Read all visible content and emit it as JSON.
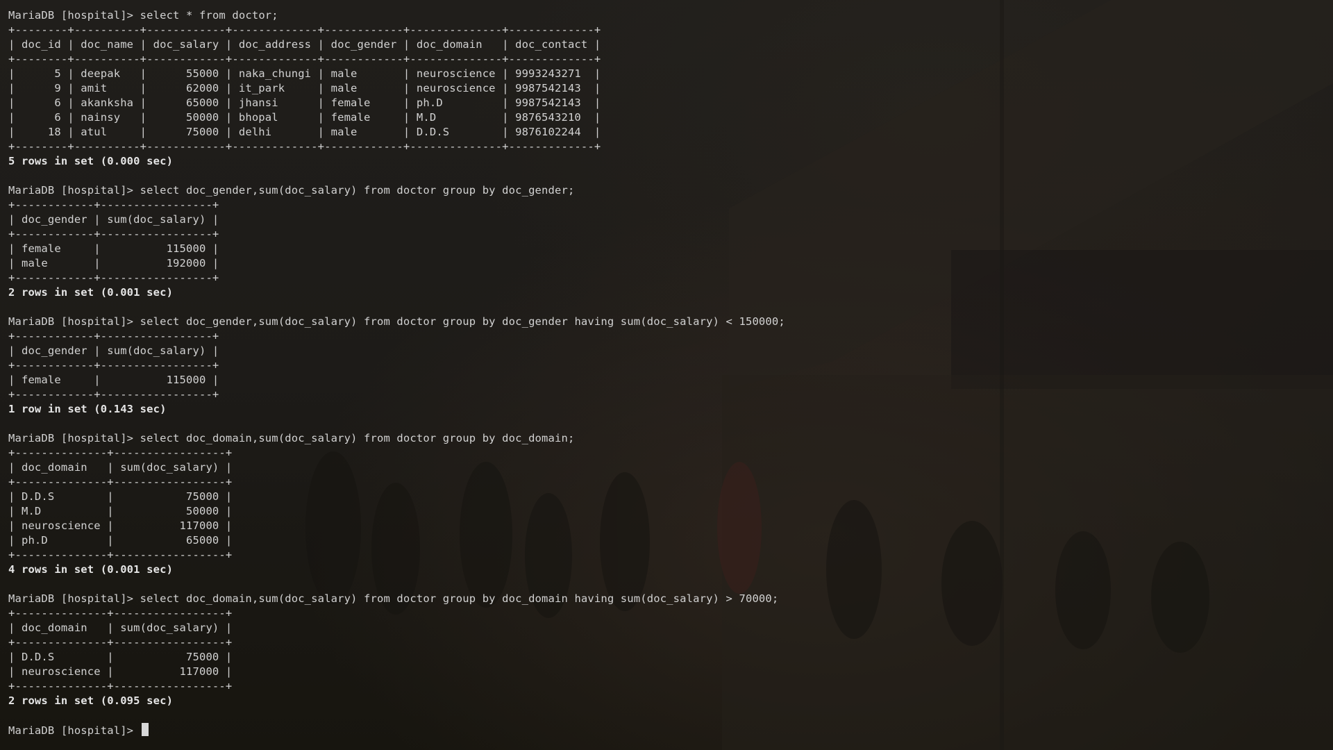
{
  "window": {
    "prompt": "MariaDB [hospital]> "
  },
  "queries": [
    {
      "command": "select * from doctor;",
      "table": [
        "+--------+----------+------------+-------------+------------+--------------+-------------+",
        "| doc_id | doc_name | doc_salary | doc_address | doc_gender | doc_domain   | doc_contact |",
        "+--------+----------+------------+-------------+------------+--------------+-------------+",
        "|      5 | deepak   |      55000 | naka_chungi | male       | neuroscience | 9993243271  |",
        "|      9 | amit     |      62000 | it_park     | male       | neuroscience | 9987542143  |",
        "|      6 | akanksha |      65000 | jhansi      | female     | ph.D         | 9987542143  |",
        "|      6 | nainsy   |      50000 | bhopal      | female     | M.D          | 9876543210  |",
        "|     18 | atul     |      75000 | delhi       | male       | D.D.S        | 9876102244  |",
        "+--------+----------+------------+-------------+------------+--------------+-------------+"
      ],
      "result": "5 rows in set (0.000 sec)"
    },
    {
      "command": "select doc_gender,sum(doc_salary) from doctor group by doc_gender;",
      "table": [
        "+------------+-----------------+",
        "| doc_gender | sum(doc_salary) |",
        "+------------+-----------------+",
        "| female     |          115000 |",
        "| male       |          192000 |",
        "+------------+-----------------+"
      ],
      "result": "2 rows in set (0.001 sec)"
    },
    {
      "command": "select doc_gender,sum(doc_salary) from doctor group by doc_gender having sum(doc_salary) < 150000;",
      "table": [
        "+------------+-----------------+",
        "| doc_gender | sum(doc_salary) |",
        "+------------+-----------------+",
        "| female     |          115000 |",
        "+------------+-----------------+"
      ],
      "result": "1 row in set (0.143 sec)"
    },
    {
      "command": "select doc_domain,sum(doc_salary) from doctor group by doc_domain;",
      "table": [
        "+--------------+-----------------+",
        "| doc_domain   | sum(doc_salary) |",
        "+--------------+-----------------+",
        "| D.D.S        |           75000 |",
        "| M.D          |           50000 |",
        "| neuroscience |          117000 |",
        "| ph.D         |           65000 |",
        "+--------------+-----------------+"
      ],
      "result": "4 rows in set (0.001 sec)"
    },
    {
      "command": "select doc_domain,sum(doc_salary) from doctor group by doc_domain having sum(doc_salary) > 70000;",
      "table": [
        "+--------------+-----------------+",
        "| doc_domain   | sum(doc_salary) |",
        "+--------------+-----------------+",
        "| D.D.S        |           75000 |",
        "| neuroscience |          117000 |",
        "+--------------+-----------------+"
      ],
      "result": "2 rows in set (0.095 sec)"
    }
  ],
  "final_prompt": "MariaDB [hospital]> ",
  "colors": {
    "text": "#d2d2d2",
    "background": "#1c1a17",
    "cursor": "#d8d8d8"
  }
}
